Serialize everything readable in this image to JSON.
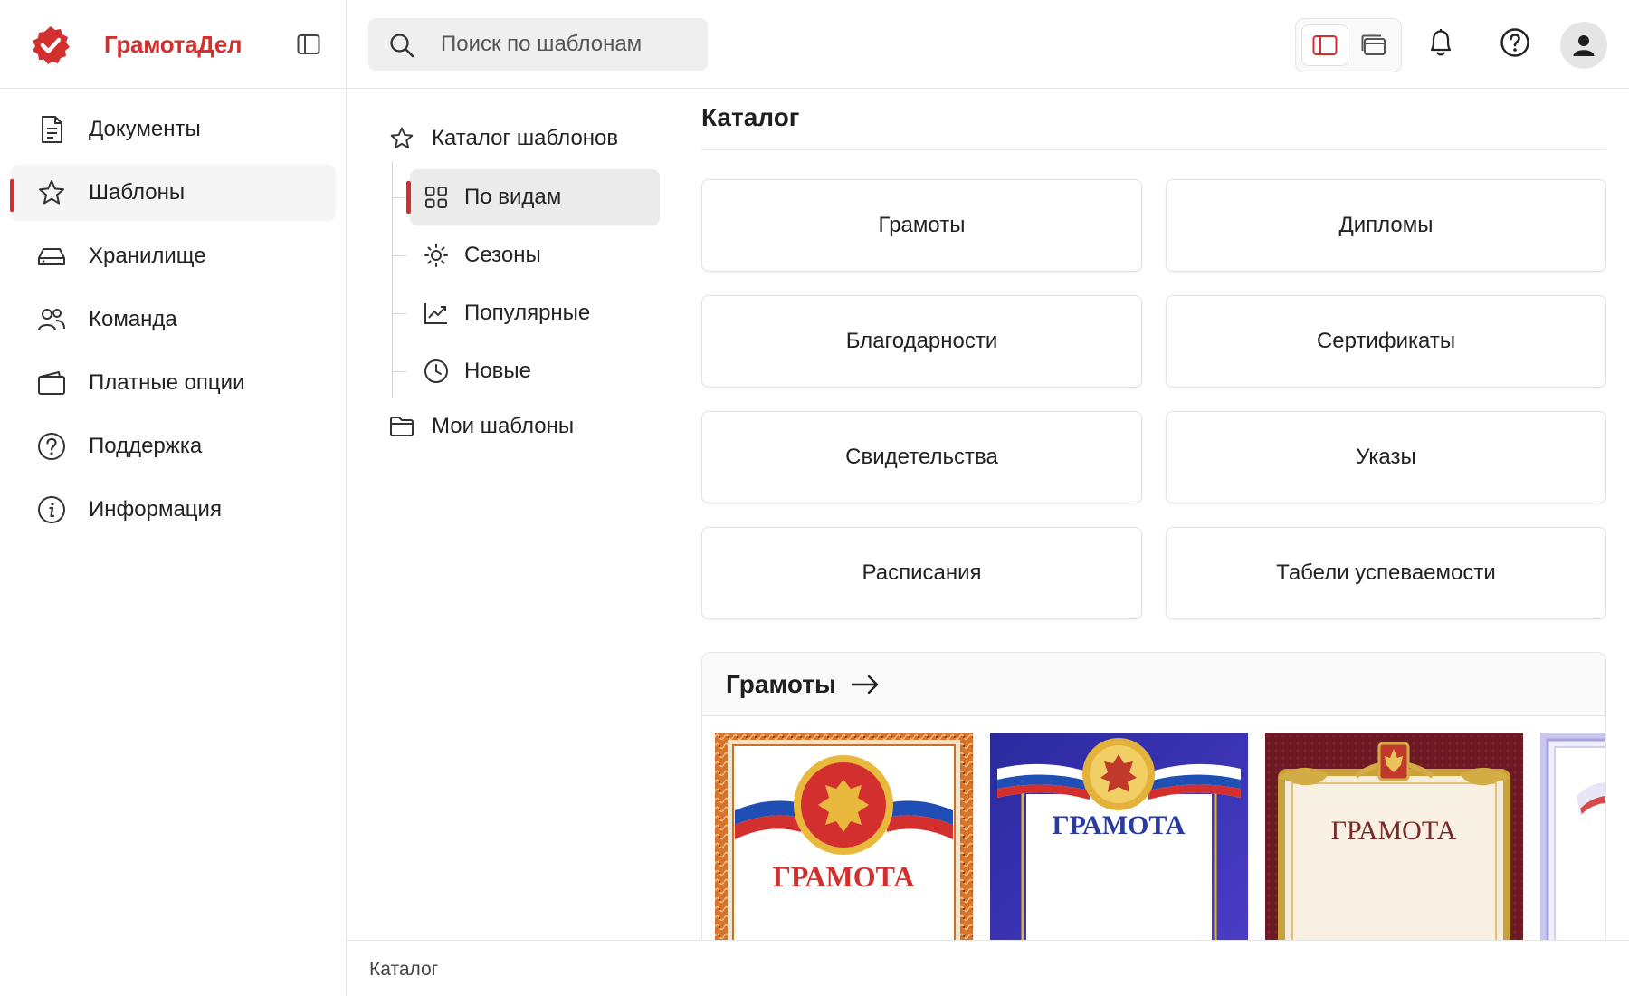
{
  "brand": {
    "name": "ГрамотаДел"
  },
  "search": {
    "placeholder": "Поиск по шаблонам"
  },
  "sidebar": {
    "items": [
      {
        "label": "Документы",
        "icon": "document-icon"
      },
      {
        "label": "Шаблоны",
        "icon": "star-icon",
        "active": true
      },
      {
        "label": "Хранилище",
        "icon": "storage-icon"
      },
      {
        "label": "Команда",
        "icon": "team-icon"
      },
      {
        "label": "Платные опции",
        "icon": "wallet-icon"
      },
      {
        "label": "Поддержка",
        "icon": "help-circle-icon"
      },
      {
        "label": "Информация",
        "icon": "info-icon"
      }
    ]
  },
  "tree": {
    "root": "Каталог шаблонов",
    "children": [
      {
        "label": "По видам",
        "icon": "grid-icon",
        "active": true
      },
      {
        "label": "Сезоны",
        "icon": "sun-icon"
      },
      {
        "label": "Популярные",
        "icon": "trending-icon"
      },
      {
        "label": "Новые",
        "icon": "clock-icon"
      }
    ],
    "mine": "Мои шаблоны"
  },
  "main": {
    "title": "Каталог",
    "categories": [
      "Грамоты",
      "Дипломы",
      "Благодарности",
      "Сертификаты",
      "Свидетельства",
      "Указы",
      "Расписания",
      "Табели успеваемости"
    ],
    "section": {
      "title": "Грамоты",
      "thumbnails": [
        {
          "caption": "ГРАМОТА",
          "style": "orange-frame"
        },
        {
          "caption": "ГРАМОТА",
          "style": "blue-frame"
        },
        {
          "caption": "ГРАМОТА",
          "style": "burgundy-gold-frame"
        },
        {
          "caption": "",
          "style": "lavender-frame"
        }
      ]
    }
  },
  "footer": {
    "text": "Каталог"
  },
  "colors": {
    "accent": "#d32f2f",
    "border": "#e6e6e6",
    "search_bg": "#efefef"
  }
}
